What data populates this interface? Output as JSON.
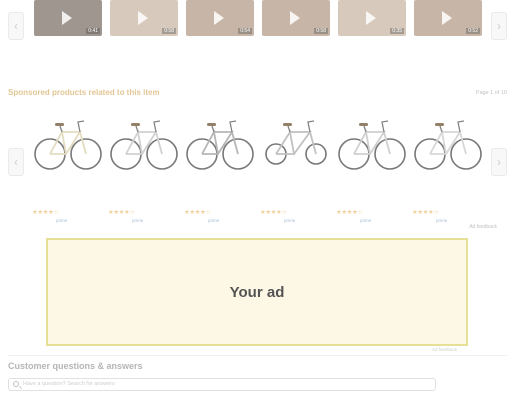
{
  "videos": [
    {
      "title": "",
      "duration": "0:41",
      "source": ""
    },
    {
      "title": "",
      "duration": "0:58",
      "source": ""
    },
    {
      "title": "",
      "duration": "0:54",
      "source": ""
    },
    {
      "title": "",
      "duration": "0:58",
      "source": ""
    },
    {
      "title": "",
      "duration": "0:35",
      "source": ""
    },
    {
      "title": "",
      "duration": "0:52",
      "source": ""
    }
  ],
  "sponsored": {
    "title": "Sponsored products related to this item",
    "page_indicator": "Page 1 of 10"
  },
  "products": [
    {
      "title": "",
      "stars": "★★★★☆",
      "rating_count": "",
      "price": "",
      "prime": "prime",
      "frame_color": "#d8cfa8"
    },
    {
      "title": "",
      "stars": "★★★★☆",
      "rating_count": "",
      "price": "",
      "prime": "prime",
      "frame_color": "#bfbfbf"
    },
    {
      "title": "",
      "stars": "★★★★☆",
      "rating_count": "",
      "price": "",
      "prime": "prime",
      "frame_color": "#9a9a9a"
    },
    {
      "title": "",
      "stars": "★★★★☆",
      "rating_count": "",
      "price": "",
      "prime": "prime",
      "frame_color": "#a9a9a9"
    },
    {
      "title": "",
      "stars": "★★★★☆",
      "rating_count": "",
      "price": "",
      "prime": "prime",
      "frame_color": "#bdbdbd"
    },
    {
      "title": "",
      "stars": "★★★★☆",
      "rating_count": "",
      "price": "",
      "prime": "prime",
      "frame_color": "#c8c8c8"
    }
  ],
  "ad_feedback_top": "Ad feedback",
  "ad": {
    "label": "Your ad",
    "feedback": "Ad feedback"
  },
  "qa": {
    "title": "Customer questions & answers",
    "search_placeholder": "Have a question? Search for answers"
  },
  "colors": {
    "ad_bg": "#fdf4dd",
    "ad_border": "#dcd46e",
    "sponsored_title": "#d8b06a"
  },
  "icons": {
    "left": "chevron-left-icon",
    "right": "chevron-right-icon",
    "play": "play-icon",
    "search": "search-icon"
  }
}
